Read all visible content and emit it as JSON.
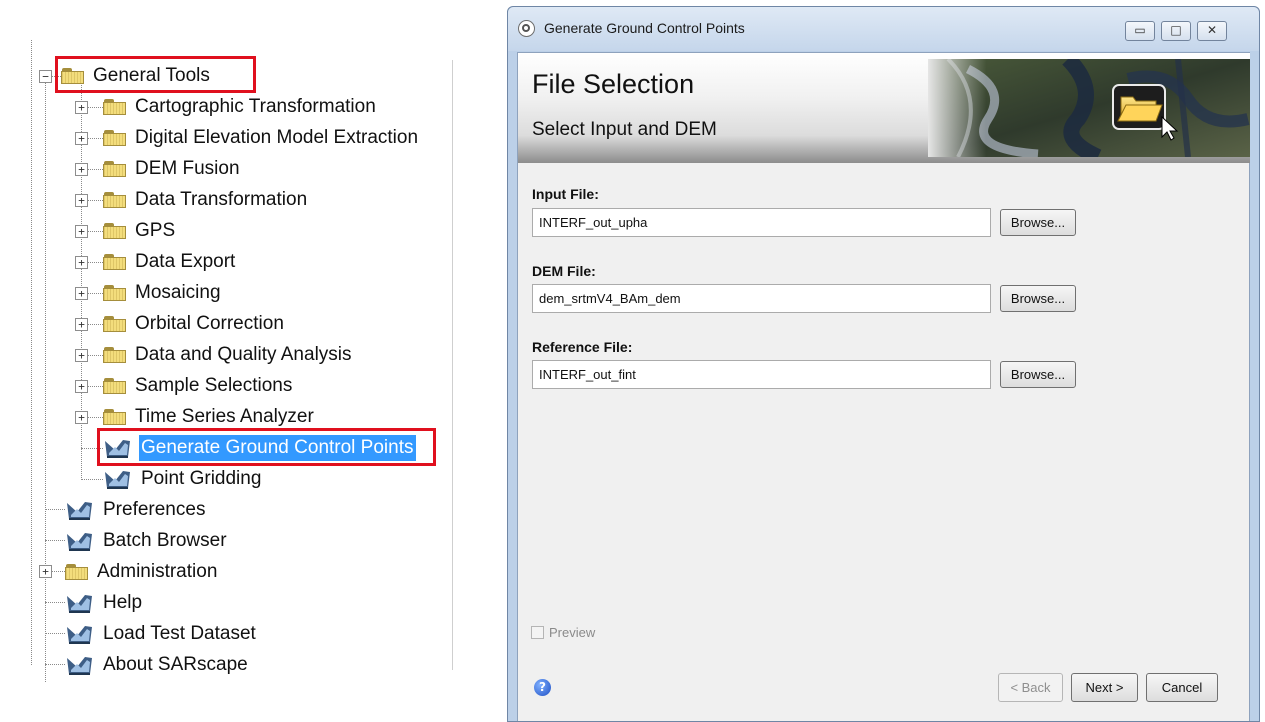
{
  "tree": {
    "items": [
      {
        "label": "General Tools"
      },
      {
        "label": "Cartographic Transformation"
      },
      {
        "label": "Digital Elevation Model Extraction"
      },
      {
        "label": "DEM Fusion"
      },
      {
        "label": "Data Transformation"
      },
      {
        "label": "GPS"
      },
      {
        "label": "Data Export"
      },
      {
        "label": "Mosaicing"
      },
      {
        "label": "Orbital Correction"
      },
      {
        "label": "Data and Quality Analysis"
      },
      {
        "label": "Sample Selections"
      },
      {
        "label": "Time Series Analyzer"
      },
      {
        "label": "Generate Ground Control Points"
      },
      {
        "label": "Point Gridding"
      },
      {
        "label": "Preferences"
      },
      {
        "label": "Batch Browser"
      },
      {
        "label": "Administration"
      },
      {
        "label": "Help"
      },
      {
        "label": "Load Test Dataset"
      },
      {
        "label": "About SARscape"
      }
    ],
    "expanded_symbol": "−",
    "collapsed_symbol": "+",
    "highlight_color": "#e0101e",
    "selection_color": "#3399ff"
  },
  "dialog": {
    "title": "Generate Ground Control Points",
    "banner_title": "File Selection",
    "banner_subtitle": "Select Input and DEM",
    "minimize_symbol": "▭",
    "maximize_symbol": "□",
    "close_symbol": "✕",
    "fields": {
      "input": {
        "label": "Input File:",
        "value": "INTERF_out_upha",
        "browse": "Browse..."
      },
      "dem": {
        "label": "DEM File:",
        "value": "dem_srtmV4_BAm_dem",
        "browse": "Browse..."
      },
      "reference": {
        "label": "Reference File:",
        "value": "INTERF_out_fint",
        "browse": "Browse..."
      }
    },
    "preview_label": "Preview",
    "preview_checked": false,
    "help_symbol": "?",
    "back_label": "< Back",
    "next_label": "Next >",
    "cancel_label": "Cancel"
  }
}
